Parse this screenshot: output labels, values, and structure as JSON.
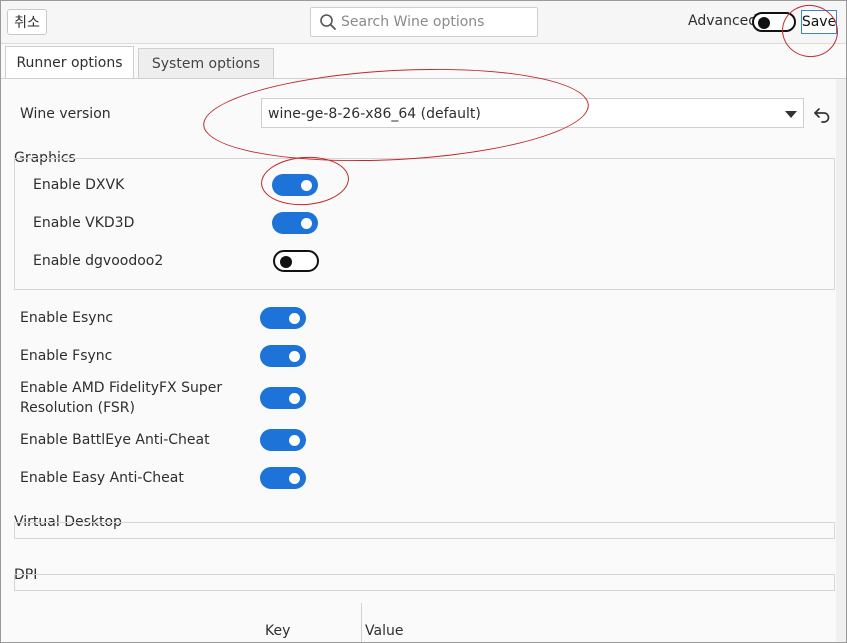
{
  "header": {
    "cancel_label": "취소",
    "search_placeholder": "Search Wine options",
    "advanced_label": "Advanced",
    "advanced_enabled": false,
    "save_label": "Save"
  },
  "tabs": [
    {
      "label": "Runner options",
      "active": true
    },
    {
      "label": "System options",
      "active": false
    }
  ],
  "wine_version": {
    "label": "Wine version",
    "value": "wine-ge-8-26-x86_64 (default)"
  },
  "graphics": {
    "title": "Graphics",
    "options": [
      {
        "label": "Enable DXVK",
        "enabled": true
      },
      {
        "label": "Enable VKD3D",
        "enabled": true
      },
      {
        "label": "Enable dgvoodoo2",
        "enabled": false
      }
    ]
  },
  "options": [
    {
      "label": "Enable Esync",
      "enabled": true
    },
    {
      "label": "Enable Fsync",
      "enabled": true
    },
    {
      "label_line1": "Enable AMD FidelityFX Super",
      "label_line2": "Resolution (FSR)",
      "enabled": true
    },
    {
      "label": "Enable BattlEye Anti-Cheat",
      "enabled": true
    },
    {
      "label": "Enable Easy Anti-Cheat",
      "enabled": true
    }
  ],
  "sections": {
    "virtual_desktop": "Virtual Desktop",
    "dpi": "DPI"
  },
  "table": {
    "key_header": "Key",
    "value_header": "Value"
  },
  "colors": {
    "accent": "#1e73d8",
    "annotation": "#c0282a"
  }
}
